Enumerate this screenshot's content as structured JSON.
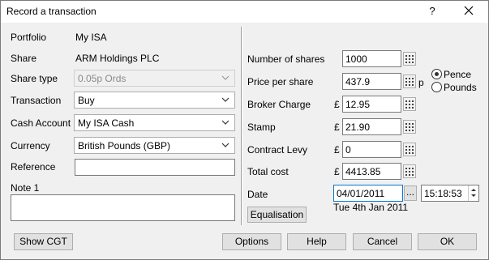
{
  "window": {
    "title": "Record a transaction",
    "help_glyph": "?"
  },
  "left": {
    "portfolio_label": "Portfolio",
    "portfolio_value": "My ISA",
    "share_label": "Share",
    "share_value": "ARM Holdings PLC",
    "share_type_label": "Share type",
    "share_type_value": "0.05p Ords",
    "transaction_label": "Transaction",
    "transaction_value": "Buy",
    "cash_account_label": "Cash Account",
    "cash_account_value": "My ISA Cash",
    "currency_label": "Currency",
    "currency_value": "British Pounds (GBP)",
    "reference_label": "Reference",
    "reference_value": "",
    "note_label": "Note 1",
    "note_value": ""
  },
  "right": {
    "shares_label": "Number of shares",
    "shares_value": "1000",
    "price_label": "Price per share",
    "price_value": "437.9",
    "price_unit": "p",
    "broker_label": "Broker Charge",
    "broker_value": "12.95",
    "stamp_label": "Stamp",
    "stamp_value": "21.90",
    "levy_label": "Contract Levy",
    "levy_value": "0",
    "total_label": "Total cost",
    "total_value": "4413.85",
    "currency_symbol": "£",
    "date_label": "Date",
    "date_value": "04/01/2011",
    "date_button": "...",
    "time_value": "15:18:53",
    "date_text": "Tue 4th Jan 2011",
    "equalisation_button": "Equalisation",
    "price_unit_options": [
      "Pence",
      "Pounds"
    ],
    "price_unit_selected": "Pence"
  },
  "footer": {
    "show_cgt": "Show CGT",
    "options": "Options",
    "help": "Help",
    "cancel": "Cancel",
    "ok": "OK"
  }
}
